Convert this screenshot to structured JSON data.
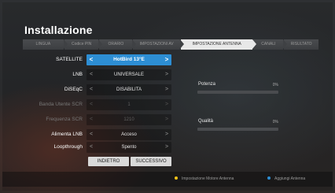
{
  "title": "Installazione",
  "steps": [
    {
      "label": "LINGUA",
      "active": false
    },
    {
      "label": "Codice PIN",
      "active": false
    },
    {
      "label": "ORARIO",
      "active": false
    },
    {
      "label": "IMPOSTAZIONI AV",
      "active": false
    },
    {
      "label": "IMPOSTAZIONE ANTENNA",
      "active": true
    },
    {
      "label": "CANALI",
      "active": false
    },
    {
      "label": "RISULTATO",
      "active": false
    }
  ],
  "settings": [
    {
      "label": "SATELLITE",
      "value": "HotBird 13°E",
      "state": "active"
    },
    {
      "label": "LNB",
      "value": "UNIVERSALE",
      "state": "normal"
    },
    {
      "label": "DiSEqC",
      "value": "DISABILITA",
      "state": "normal"
    },
    {
      "label": "Banda Utente SCR",
      "value": "1",
      "state": "disabled"
    },
    {
      "label": "Frequenza SCR",
      "value": "1210",
      "state": "disabled"
    },
    {
      "label": "Alimenta LNB",
      "value": "Acceso",
      "state": "normal"
    },
    {
      "label": "Loopthrough",
      "value": "Spento",
      "state": "normal"
    }
  ],
  "buttons": {
    "back": "INDIETRO",
    "next": "SUCCESSIVO"
  },
  "meters": {
    "power": {
      "label": "Potenza",
      "value": "0%",
      "level": 0
    },
    "quality": {
      "label": "Qualità",
      "value": "0%",
      "level": 0
    }
  },
  "hints": {
    "yellow": "Impostazione Motore Antenna",
    "blue": "Aggiungi Antenna"
  },
  "colors": {
    "accent": "#2d8ed4",
    "yellow_key": "#f2c318",
    "blue_key": "#2d8ed4"
  },
  "icons": {
    "left_arrow": "chevron-left-icon",
    "right_arrow": "chevron-right-icon"
  }
}
